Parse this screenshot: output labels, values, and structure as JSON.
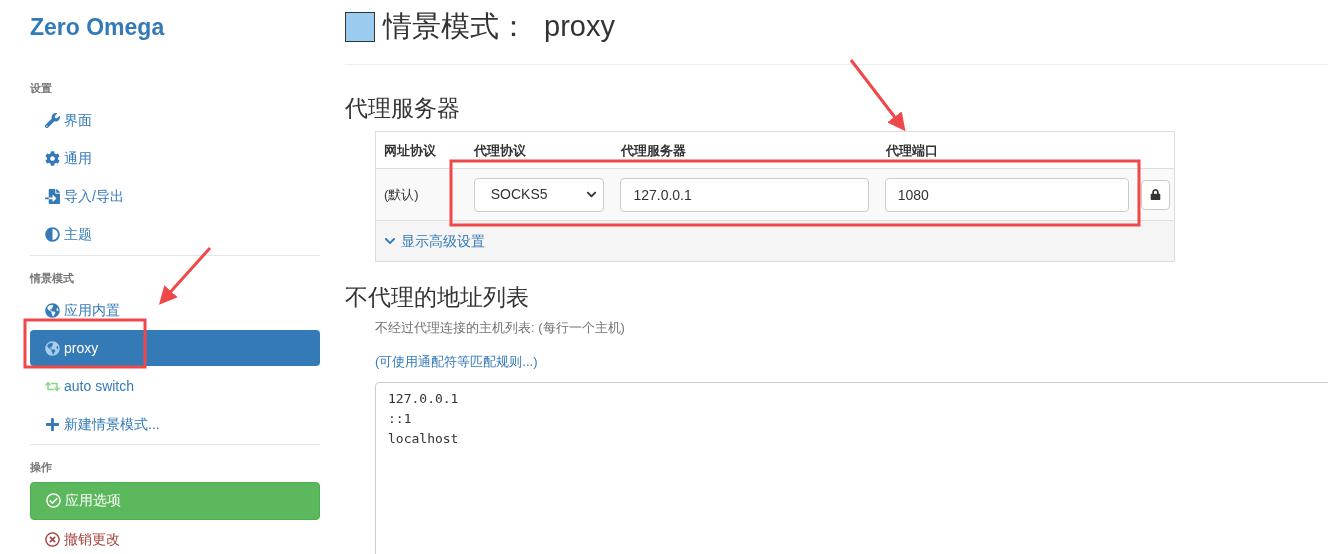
{
  "sidebar": {
    "brand": "Zero Omega",
    "sections": [
      {
        "header": "设置",
        "items": [
          {
            "label": "界面",
            "kind": "interface",
            "selected": false
          },
          {
            "label": "通用",
            "kind": "general",
            "selected": false
          },
          {
            "label": "导入/导出",
            "kind": "io",
            "selected": false
          },
          {
            "label": "主题",
            "kind": "theme",
            "selected": false
          }
        ]
      },
      {
        "header": "情景模式",
        "items": [
          {
            "label": "应用内置",
            "kind": "builtin",
            "selected": false
          },
          {
            "label": "proxy",
            "kind": "profile",
            "selected": true
          },
          {
            "label": "auto switch",
            "kind": "switch",
            "selected": false
          },
          {
            "label": "新建情景模式...",
            "kind": "new",
            "selected": false
          }
        ]
      },
      {
        "header": "操作",
        "items": [
          {
            "label": "应用选项",
            "kind": "apply"
          },
          {
            "label": "撤销更改",
            "kind": "revert"
          }
        ]
      }
    ]
  },
  "main": {
    "title_label": "情景模式：",
    "profile_name": "proxy",
    "proxy_servers": {
      "heading": "代理服务器",
      "columns": [
        "网址协议",
        "代理协议",
        "代理服务器",
        "代理端口"
      ],
      "row": {
        "scheme": "(默认)",
        "protocol": "SOCKS5",
        "server": "127.0.0.1",
        "port": "1080"
      },
      "advanced_link": "显示高级设置"
    },
    "bypass": {
      "heading": "不代理的地址列表",
      "help": "不经过代理连接的主机列表: (每行一个主机)",
      "link": "(可使用通配符等匹配规则...)",
      "lines": [
        "127.0.0.1",
        "::1",
        "localhost"
      ]
    }
  }
}
